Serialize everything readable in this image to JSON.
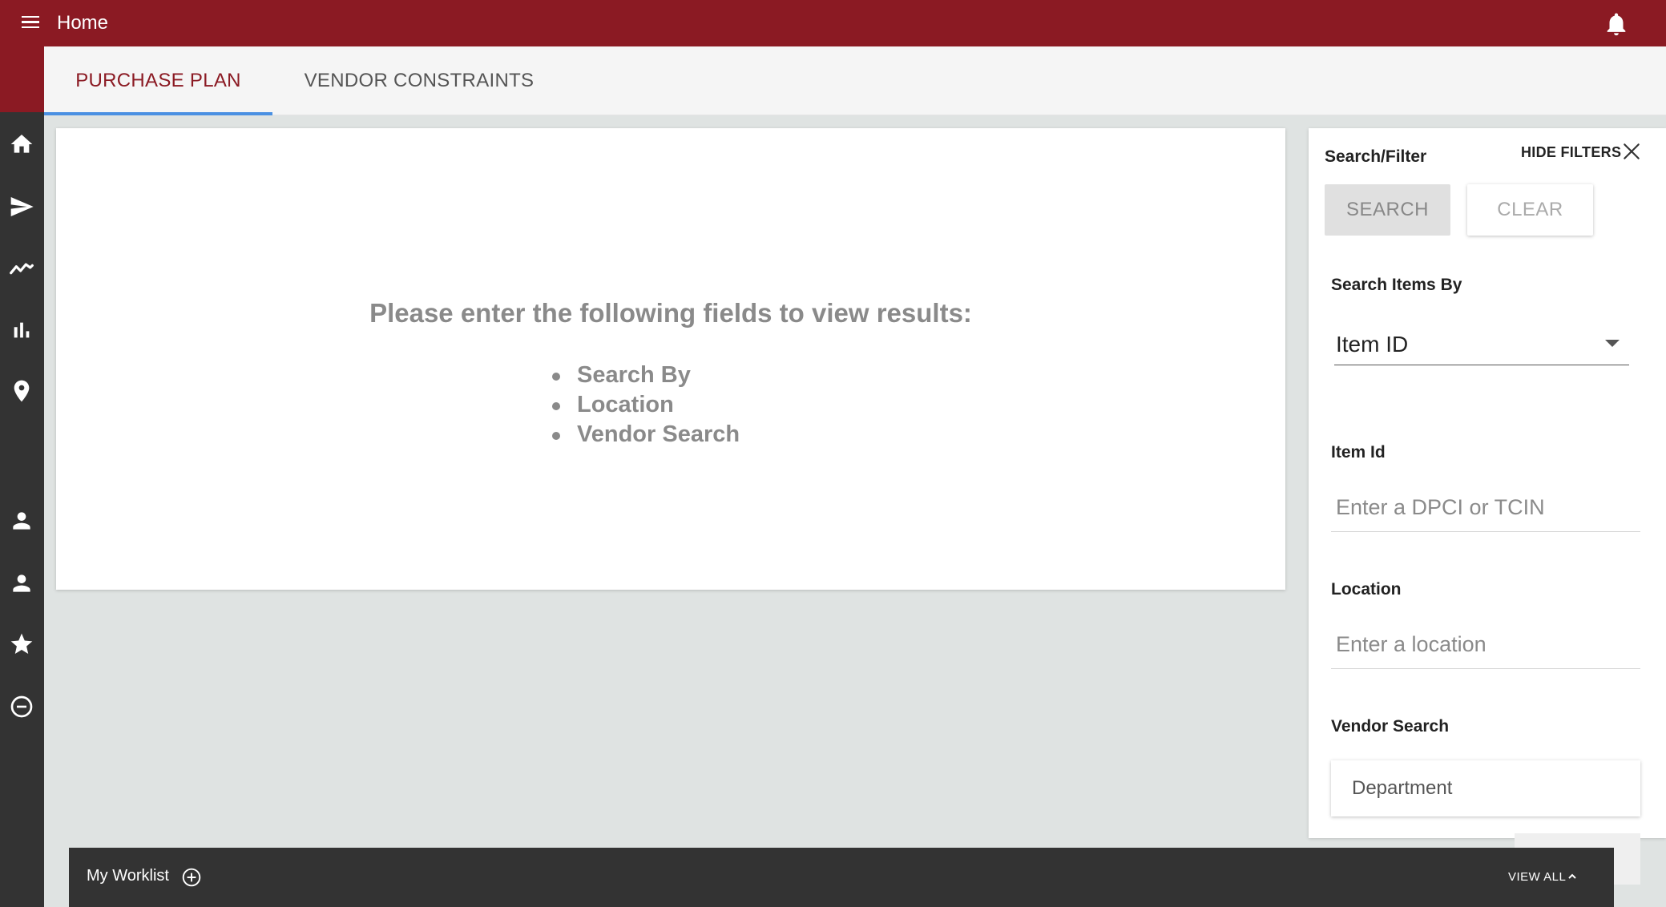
{
  "app": {
    "title": "Home"
  },
  "icons": {
    "menu": "menu-icon",
    "bell": "bell-icon",
    "nav": [
      "home-icon",
      "send-icon",
      "trend-line-icon",
      "bar-chart-icon",
      "location-pin-icon",
      "person-icon",
      "person-icon",
      "star-icon",
      "minus-circle-icon"
    ]
  },
  "tabs": [
    {
      "label": "PURCHASE PLAN",
      "active": true
    },
    {
      "label": "VENDOR CONSTRAINTS",
      "active": false
    }
  ],
  "main": {
    "message": "Please enter the following fields to view results:",
    "fields": [
      "Search By",
      "Location",
      "Vendor Search"
    ]
  },
  "filters": {
    "title": "Search/Filter",
    "hide_label": "HIDE FILTERS",
    "search_button": "SEARCH",
    "clear_button": "CLEAR",
    "search_by_label": "Search Items By",
    "search_by_value": "Item ID",
    "item_id_label": "Item Id",
    "item_id_placeholder": "Enter a DPCI or TCIN",
    "location_label": "Location",
    "location_placeholder": "Enter a location",
    "vendor_label": "Vendor Search",
    "vendor_value": "Department"
  },
  "worklist": {
    "label": "My Worklist",
    "view_all": "VIEW ALL"
  },
  "colors": {
    "brand": "#8b1a23",
    "nav_bg": "#333333",
    "tab_ink": "#4a90e2"
  }
}
